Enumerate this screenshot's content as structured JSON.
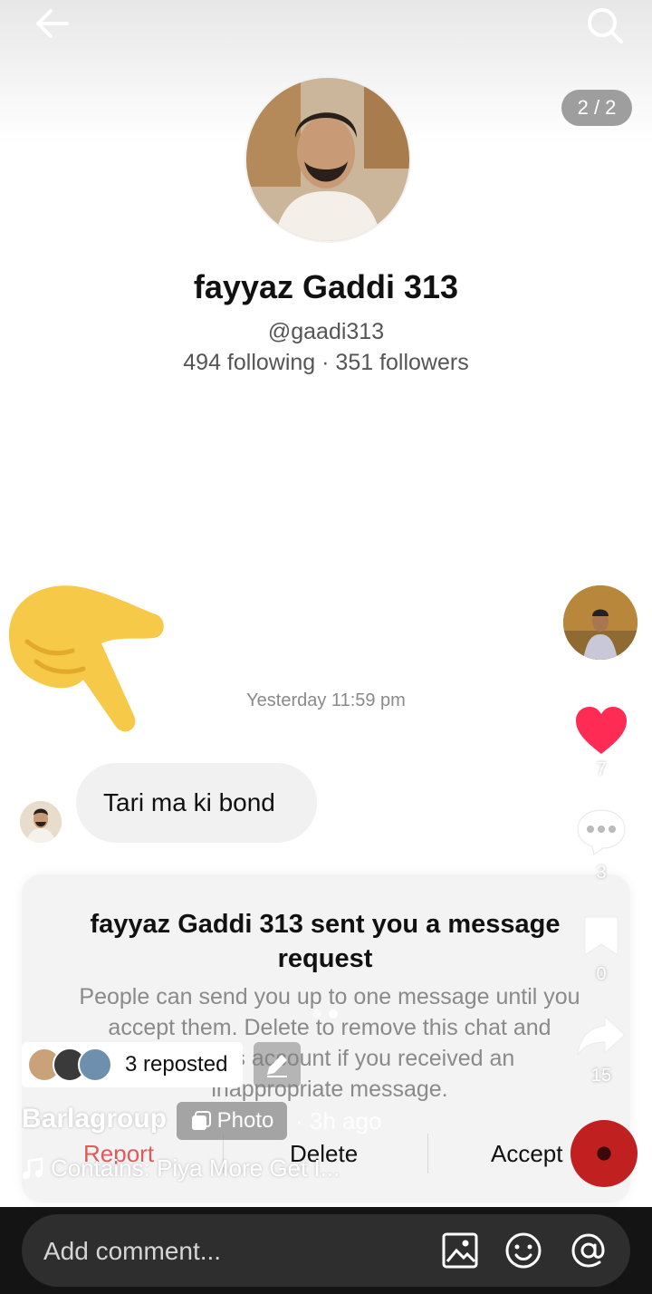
{
  "header": {
    "back_icon": "arrow-left-icon",
    "search_icon": "search-icon",
    "page_counter": "2 / 2"
  },
  "profile": {
    "name": "fayyaz Gaddi 313",
    "handle": "@gaadi313",
    "stats": "494 following · 351 followers"
  },
  "chat": {
    "timestamp": "Yesterday 11:59 pm",
    "message": "Tari ma ki bond"
  },
  "request_card": {
    "title": "fayyaz Gaddi 313 sent you a message request",
    "body": "People can send you up to one message until you accept them. Delete to remove this chat and report this account if you received an inappropriate message.",
    "report_label": "Report",
    "delete_label": "Delete",
    "accept_label": "Accept"
  },
  "actions": {
    "likes": "7",
    "comments": "3",
    "saves": "0",
    "shares": "15",
    "like_color": "#fe2c55"
  },
  "post": {
    "reposted_label": "3 reposted",
    "author": "Barlagroup",
    "type_label": "Photo",
    "time_ago": "· 3h ago",
    "music": "Contains: Piya More Get I..."
  },
  "comment_bar": {
    "placeholder": "Add comment...",
    "icons": [
      "image-icon",
      "emoji-icon",
      "mention-icon"
    ]
  }
}
